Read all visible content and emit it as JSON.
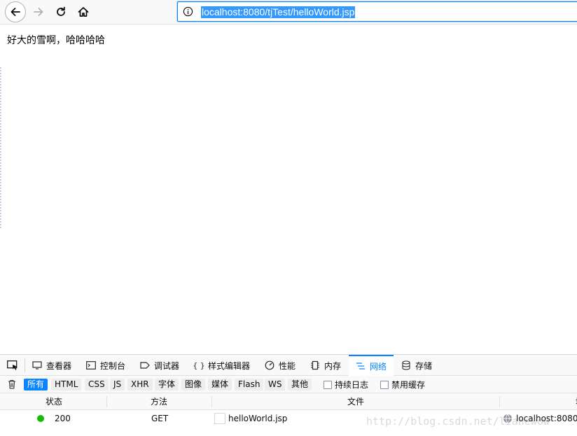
{
  "browser": {
    "url": "localhost:8080/tjTest/helloWorld.jsp",
    "icons": {
      "back": "back-arrow-icon",
      "forward": "forward-arrow-icon",
      "reload": "reload-icon",
      "home": "home-icon",
      "site_info": "info-icon"
    }
  },
  "page": {
    "text": "好大的雪啊，哈哈哈哈"
  },
  "devtools": {
    "tabs": [
      {
        "label": "查看器",
        "icon": "inspector-icon"
      },
      {
        "label": "控制台",
        "icon": "console-icon"
      },
      {
        "label": "调试器",
        "icon": "debugger-icon"
      },
      {
        "label": "样式编辑器",
        "icon": "style-editor-icon"
      },
      {
        "label": "性能",
        "icon": "performance-icon"
      },
      {
        "label": "内存",
        "icon": "memory-icon"
      },
      {
        "label": "网络",
        "icon": "network-icon"
      },
      {
        "label": "存储",
        "icon": "storage-icon"
      }
    ],
    "selected_tab": "网络",
    "filters": [
      "所有",
      "HTML",
      "CSS",
      "JS",
      "XHR",
      "字体",
      "图像",
      "媒体",
      "Flash",
      "WS",
      "其他"
    ],
    "active_filter": "所有",
    "checkboxes": [
      {
        "label": "持续日志",
        "checked": false
      },
      {
        "label": "禁用缓存",
        "checked": false
      }
    ],
    "columns": [
      "状态",
      "方法",
      "文件",
      "域名"
    ],
    "requests": [
      {
        "status": "200",
        "method": "GET",
        "file": "helloWorld.jsp",
        "domain": "localhost:8080"
      }
    ],
    "colors": {
      "accent": "#0a84ff",
      "status_ok": "#12bc00"
    }
  },
  "watermark": "http://blog.csdn.net/lianewow"
}
